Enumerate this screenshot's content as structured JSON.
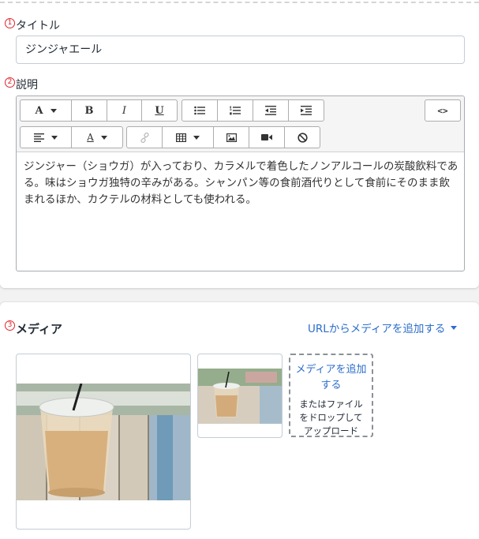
{
  "title_section": {
    "number": "1",
    "label": "タイトル",
    "value": "ジンジャエール"
  },
  "description_section": {
    "number": "2",
    "label": "説明",
    "text": "ジンジャー（ショウガ）が入っており、カラメルで着色したノンアルコールの炭酸飲料である。味はショウガ独特の辛みがある。シャンパン等の食前酒代りとして食前にそのまま飲まれるほか、カクテルの材料としても使われる。"
  },
  "toolbar": {
    "font_label": "A",
    "bold_label": "B",
    "italic_label": "I",
    "underline_label": "U",
    "code_label": "<>",
    "font_color_label": "A"
  },
  "media_section": {
    "number": "3",
    "label": "メディア",
    "add_url": "URLからメディアを追加する",
    "dropzone_add": "メディアを追加する",
    "dropzone_hint": "またはファイルをドロップしてアップロード"
  },
  "colors": {
    "accent": "#2c6ecb",
    "marker": "#e0242b"
  },
  "icons": [
    "caret-down-icon",
    "bullet-list-icon",
    "numbered-list-icon",
    "outdent-icon",
    "indent-icon",
    "code-view-icon",
    "align-left-icon",
    "link-icon",
    "table-icon",
    "image-icon",
    "video-icon",
    "clear-format-icon"
  ]
}
